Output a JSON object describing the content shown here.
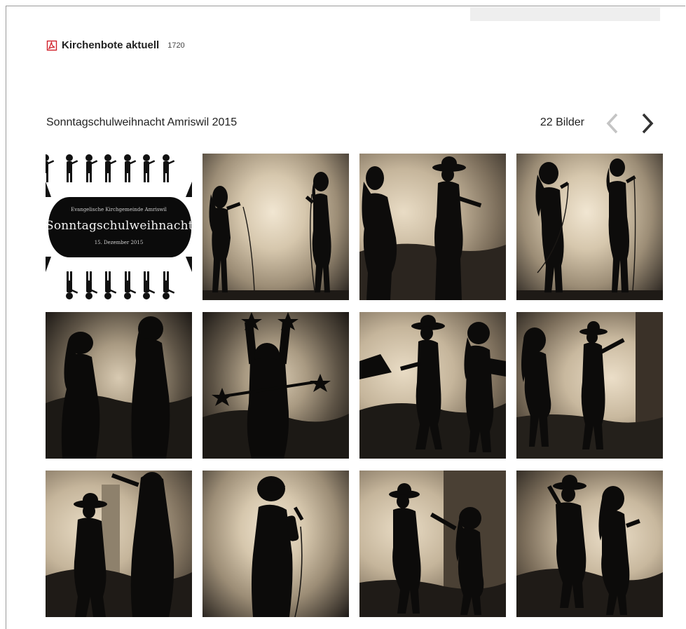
{
  "file_link": {
    "icon": "pdf-icon",
    "name": "Kirchenbote aktuell",
    "count": "1720",
    "icon_color": "#d0202a"
  },
  "gallery": {
    "title": "Sonntagschulweihnacht Amriswil 2015",
    "count_label": "22 Bilder",
    "prev_icon": "chevron-left-icon",
    "next_icon": "chevron-right-icon",
    "cover": {
      "line_top": "Evangelische Kirchgemeinde Amriswil",
      "title": "Sonntagschulweihnacht",
      "line_bottom": "15. Dezember 2015"
    },
    "thumbnails": [
      {
        "scene": "cover-collage"
      },
      {
        "scene": "two-singers-microphones"
      },
      {
        "scene": "girl-and-child-with-hat"
      },
      {
        "scene": "two-singers-microphones"
      },
      {
        "scene": "two-girls-head-bowed"
      },
      {
        "scene": "child-raising-stars"
      },
      {
        "scene": "two-children-with-hat"
      },
      {
        "scene": "two-girls-by-wall"
      },
      {
        "scene": "child-with-hat-and-figure"
      },
      {
        "scene": "boy-singing-microphone"
      },
      {
        "scene": "child-with-hat-and-girl"
      },
      {
        "scene": "child-with-hat-and-girl"
      }
    ]
  }
}
